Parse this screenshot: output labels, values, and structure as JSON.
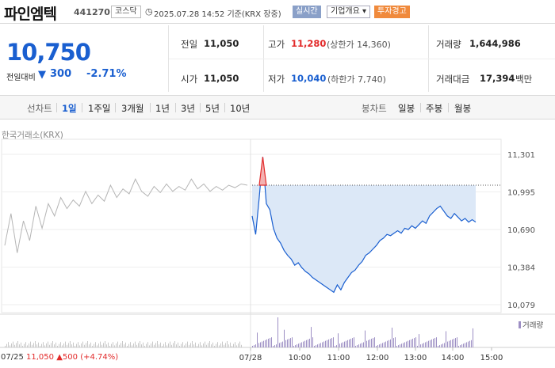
{
  "header": {
    "stock_name": "파인엠텍",
    "stock_code": "441270",
    "market": "코스닥",
    "datetime": "2025.07.28 14:52",
    "basis": "기준(KRX 장중)",
    "realtime_button": "실시간",
    "company_info_button": "기업개요",
    "warning_badge": "투자경고"
  },
  "quote": {
    "price": "10,750",
    "change_label": "전일대비",
    "change_value": "300",
    "change_percent": "-2.71%",
    "prev_close_label": "전일",
    "prev_close": "11,050",
    "high_label": "고가",
    "high": "11,280",
    "upper_limit": "(상한가 14,360)",
    "volume_label": "거래량",
    "volume": "1,644,986",
    "open_label": "시가",
    "open": "11,050",
    "low_label": "저가",
    "low": "10,040",
    "lower_limit": "(하한가 7,740)",
    "amount_label": "거래대금",
    "amount": "17,394",
    "amount_unit": "백만",
    "down_color": "#1a5fd0",
    "up_color": "#e22a2a"
  },
  "range_tabs": {
    "head": "선차트",
    "items": [
      "1일",
      "1주일",
      "3개월",
      "1년",
      "3년",
      "5년",
      "10년"
    ],
    "active_index": 0
  },
  "candle_tabs": {
    "head": "봉차트",
    "items": [
      "일봉",
      "주봉",
      "월봉"
    ]
  },
  "chart": {
    "source": "한국거래소(KRX)",
    "prev_day_summary": {
      "date": "07/25",
      "close": "11,050",
      "change": "500",
      "change_percent": "(+4.74%)"
    },
    "volume_legend": "거래량",
    "today_date": "07/28",
    "fill_color": "#dce8f7",
    "line_color": "#1a5fd0",
    "prev_line_color": "#b5b5b5"
  },
  "chart_data": {
    "type": "line",
    "y_ticks": [
      "11,301",
      "10,995",
      "10,690",
      "10,384",
      "10,079"
    ],
    "ylim": [
      10079,
      11301
    ],
    "x_ticks": [
      "07/25",
      "07/28",
      "10:00",
      "11:00",
      "12:00",
      "13:00",
      "14:00",
      "15:00"
    ],
    "reference_price": 11050,
    "series": [
      {
        "name": "07/25",
        "values": [
          10560,
          10820,
          10500,
          10760,
          10600,
          10880,
          10700,
          10900,
          10800,
          10950,
          10860,
          10930,
          10880,
          11000,
          10900,
          10970,
          10920,
          11050,
          10950,
          11020,
          10980,
          11100,
          11000,
          10960,
          11040,
          10990,
          11060,
          11000,
          11040,
          11010,
          11100,
          11020,
          11060,
          11000,
          11040,
          11010,
          11050,
          11030,
          11060,
          11050
        ]
      },
      {
        "name": "07/28",
        "values": [
          10800,
          10650,
          10950,
          11280,
          10900,
          10850,
          10700,
          10620,
          10580,
          10520,
          10480,
          10450,
          10400,
          10420,
          10380,
          10350,
          10330,
          10300,
          10280,
          10260,
          10240,
          10220,
          10200,
          10180,
          10240,
          10200,
          10260,
          10300,
          10340,
          10360,
          10400,
          10430,
          10480,
          10500,
          10530,
          10560,
          10600,
          10620,
          10650,
          10640,
          10660,
          10680,
          10660,
          10700,
          10690,
          10720,
          10700,
          10730,
          10760,
          10740,
          10800,
          10830,
          10860,
          10880,
          10840,
          10800,
          10780,
          10820,
          10790,
          10760,
          10780,
          10750,
          10770,
          10750
        ]
      }
    ]
  }
}
